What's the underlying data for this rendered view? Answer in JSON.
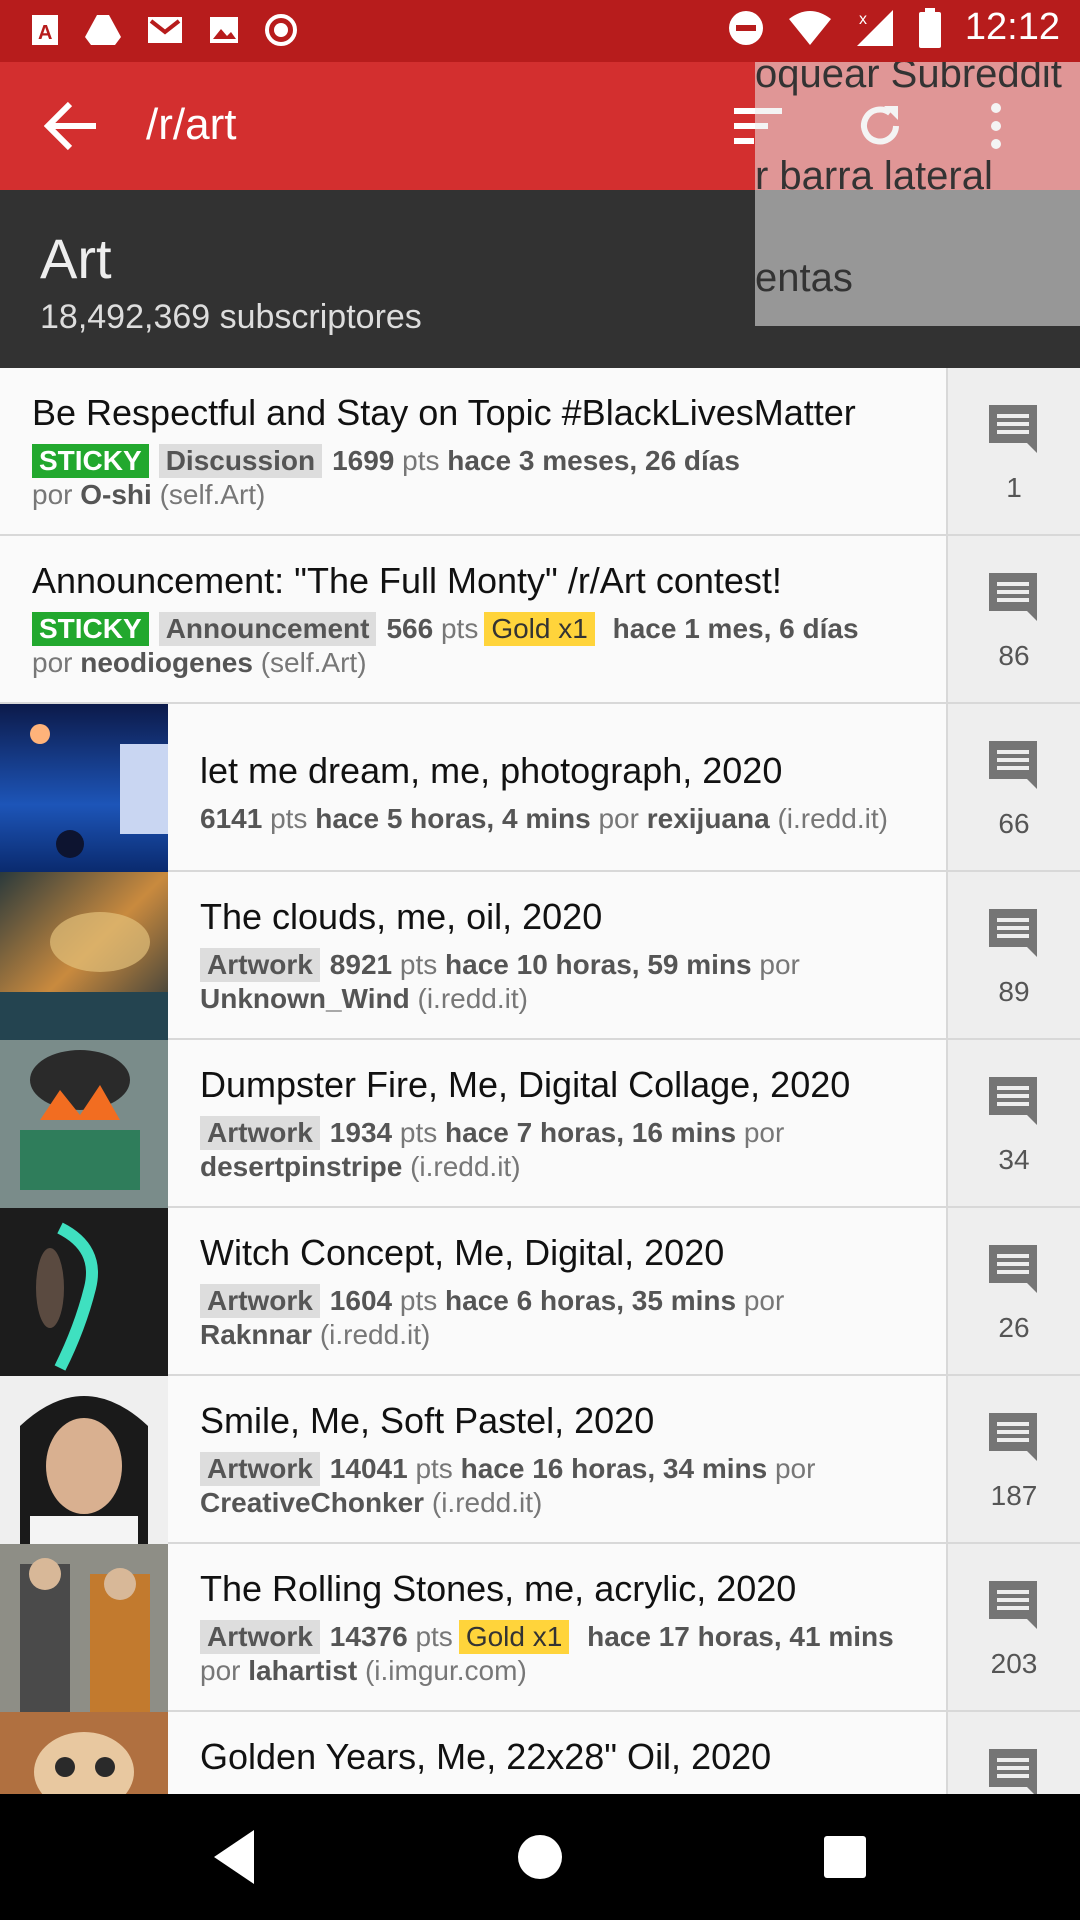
{
  "status": {
    "time": "12:12"
  },
  "toolbar": {
    "title": "/r/art"
  },
  "header": {
    "title": "Art",
    "subscribers": "18,492,369 subscriptores"
  },
  "menu_overlay": {
    "items": [
      "oquear Subreddit",
      "r barra lateral",
      "entas"
    ]
  },
  "posts": [
    {
      "title": "Be Respectful and Stay on Topic #BlackLivesMatter",
      "sticky": "STICKY",
      "flair": "Discussion",
      "score": "1699",
      "pts": "pts",
      "time": "hace 3 meses, 26 días",
      "por": "por",
      "author": "O-shi",
      "domain": "(self.Art)",
      "comments": "1"
    },
    {
      "title": "Announcement: \"The Full Monty\" /r/Art contest!",
      "sticky": "STICKY",
      "flair": "Announcement",
      "score": "566",
      "pts": "pts",
      "gold": "Gold x1",
      "time": "hace 1 mes, 6 días",
      "por": "por",
      "author": "neodiogenes",
      "domain": "(self.Art)",
      "comments": "86"
    },
    {
      "title": "let me dream, me, photograph, 2020",
      "score": "6141",
      "pts": "pts",
      "time": "hace 5 horas, 4 mins",
      "por": "por",
      "author": "rexijuana",
      "domain": "(i.redd.it)",
      "comments": "66"
    },
    {
      "title": "The clouds, me, oil, 2020",
      "flair": "Artwork",
      "score": "8921",
      "pts": "pts",
      "time": "hace 10 horas, 59 mins",
      "por": "por",
      "author": "Unknown_Wind",
      "domain": "(i.redd.it)",
      "comments": "89"
    },
    {
      "title": "Dumpster Fire, Me, Digital Collage, 2020",
      "flair": "Artwork",
      "score": "1934",
      "pts": "pts",
      "time": "hace 7 horas, 16 mins",
      "por": "por",
      "author": "desertpinstripe",
      "domain": "(i.redd.it)",
      "comments": "34"
    },
    {
      "title": "Witch Concept, Me, Digital, 2020",
      "flair": "Artwork",
      "score": "1604",
      "pts": "pts",
      "time": "hace 6 horas, 35 mins",
      "por": "por",
      "author": "Raknnar",
      "domain": "(i.redd.it)",
      "comments": "26"
    },
    {
      "title": "Smile, Me, Soft Pastel, 2020",
      "flair": "Artwork",
      "score": "14041",
      "pts": "pts",
      "time": "hace 16 horas, 34 mins",
      "por": "por",
      "author": "CreativeChonker",
      "domain": "(i.redd.it)",
      "comments": "187"
    },
    {
      "title": "The Rolling Stones, me, acrylic, 2020",
      "flair": "Artwork",
      "score": "14376",
      "pts": "pts",
      "gold": "Gold x1",
      "time": "hace 17 horas, 41 mins",
      "por": "por",
      "author": "lahartist",
      "domain": "(i.imgur.com)",
      "comments": "203"
    },
    {
      "title": "Golden Years, Me, 22x28\" Oil, 2020"
    }
  ]
}
